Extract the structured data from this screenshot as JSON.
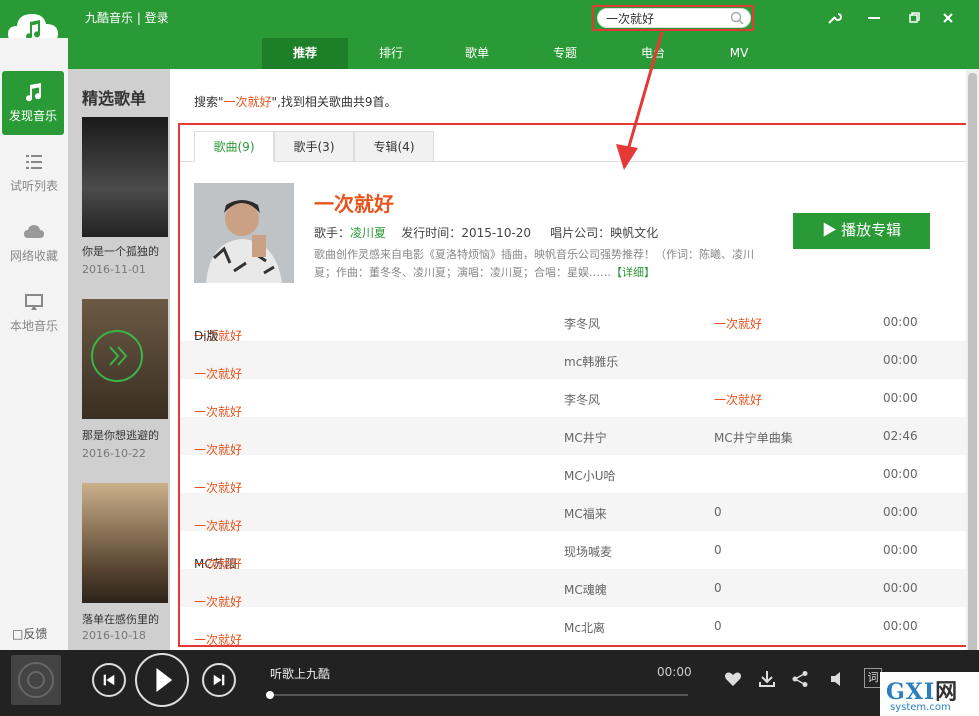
{
  "app": {
    "title": "九酷音乐 | 登录"
  },
  "search": {
    "value": "一次就好"
  },
  "window_buttons": {
    "settings": "tool-icon",
    "minimize": "minimize-icon",
    "restore": "restore-icon",
    "close": "close-icon"
  },
  "nav": {
    "tabs": [
      {
        "label": "推荐",
        "active": true
      },
      {
        "label": "排行"
      },
      {
        "label": "歌单"
      },
      {
        "label": "专题"
      },
      {
        "label": "电台"
      },
      {
        "label": "MV"
      }
    ]
  },
  "sidebar": {
    "items": [
      {
        "label": "发现音乐",
        "icon": "music-note-icon",
        "active": true
      },
      {
        "label": "试听列表",
        "icon": "list-icon"
      },
      {
        "label": "网络收藏",
        "icon": "cloud-icon"
      },
      {
        "label": "本地音乐",
        "icon": "computer-icon"
      }
    ],
    "feedback": "反馈"
  },
  "discover": {
    "section_title": "精选歌单",
    "cards": [
      {
        "caption": "你是一个孤独的",
        "date": "2016-11-01"
      },
      {
        "caption": "那是你想逃避的",
        "date": "2016-10-22"
      },
      {
        "caption": "落单在感伤里的",
        "date": "2016-10-18"
      }
    ]
  },
  "result": {
    "summary_prefix": "搜索\"",
    "keyword": "一次就好",
    "summary_suffix": "\",找到相关歌曲共9首。",
    "tabs": [
      {
        "label": "歌曲(9)",
        "active": true
      },
      {
        "label": "歌手(3)"
      },
      {
        "label": "专辑(4)"
      }
    ]
  },
  "album": {
    "title": "一次就好",
    "singer_label": "歌手：",
    "singer": "凌川夏",
    "release_label": "发行时间：",
    "release": "2015-10-20",
    "company_label": "唱片公司：",
    "company": "映帆文化",
    "description": "歌曲创作灵感来自电影《夏洛特烦恼》插曲，映帆音乐公司强势推荐！（作词：陈曦、凌川夏；作曲：董冬冬、凌川夏；演唱：凌川夏；合唱：星娱……",
    "more": "【详细】",
    "play_button": "▶ 播放专辑"
  },
  "songs": [
    {
      "name_hl": "一次就好",
      "name_rest": "Dj版",
      "artist": "李冬风",
      "album": "一次就好",
      "album_hl": true,
      "duration": "00:00"
    },
    {
      "name_hl": "一次就好",
      "name_rest": "",
      "artist": "mc韩雅乐",
      "album": "",
      "album_hl": false,
      "duration": "00:00"
    },
    {
      "name_hl": "一次就好",
      "name_rest": "",
      "artist": "李冬风",
      "album": "一次就好",
      "album_hl": true,
      "duration": "00:00"
    },
    {
      "name_hl": "一次就好",
      "name_rest": "",
      "artist": "MC井宁",
      "album": "MC井宁单曲集",
      "album_hl": false,
      "duration": "02:46"
    },
    {
      "name_hl": "一次就好",
      "name_rest": "",
      "artist": "MC小U哈",
      "album": "",
      "album_hl": false,
      "duration": "00:00"
    },
    {
      "name_hl": "一次就好",
      "name_rest": "",
      "artist": "MC福来",
      "album": "0",
      "album_hl": false,
      "duration": "00:00"
    },
    {
      "name_pre": "MC苏阳 ",
      "name_hl": "一次就好",
      "name_rest": "",
      "artist": "现场喊麦",
      "album": "0",
      "album_hl": false,
      "duration": "00:00"
    },
    {
      "name_hl": "一次就好",
      "name_rest": "",
      "artist": "MC魂魄",
      "album": "0",
      "album_hl": false,
      "duration": "00:00"
    },
    {
      "name_hl": "一次就好",
      "name_rest": "",
      "artist": "Mc北离",
      "album": "0",
      "album_hl": false,
      "duration": "00:00"
    }
  ],
  "player": {
    "title": "听歌上九酷",
    "time": "00:00",
    "progress": 0.0,
    "lyric_label": "词"
  },
  "watermark": {
    "main": "GXI",
    "net": "网",
    "sub": "system.com"
  },
  "colors": {
    "brand": "#2a9a36",
    "highlight": "#e8541e",
    "annotation": "#e53935"
  }
}
